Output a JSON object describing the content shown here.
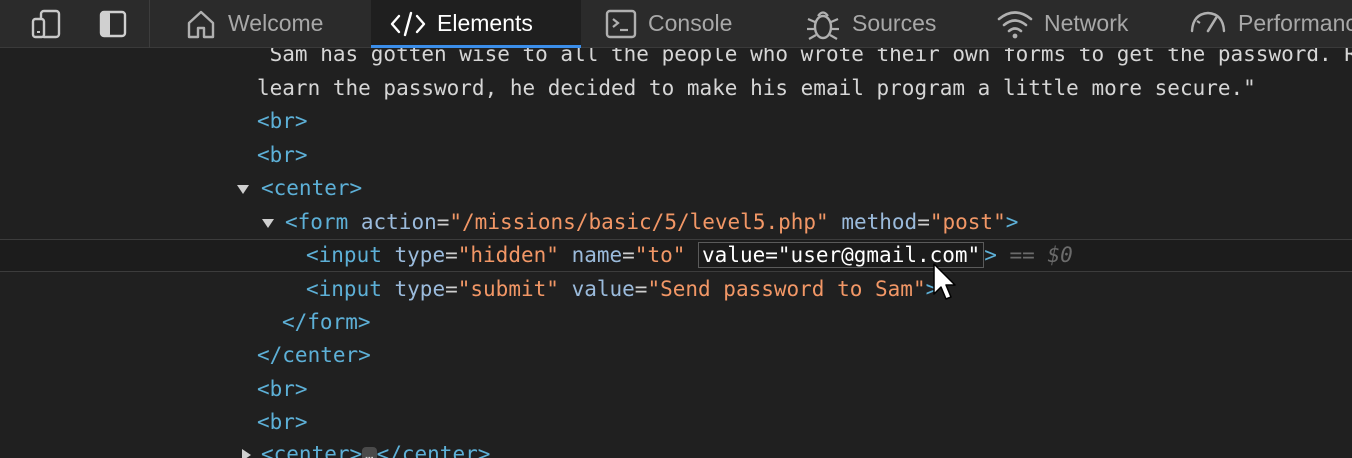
{
  "toolbar": {
    "device_icon": "device-emulation-icon",
    "dock_icon": "dock-panel-icon",
    "tabs": [
      {
        "label": "Welcome",
        "icon": "home-icon",
        "active": false
      },
      {
        "label": "Elements",
        "icon": "code-brackets-icon",
        "active": true
      },
      {
        "label": "Console",
        "icon": "console-icon",
        "active": false
      },
      {
        "label": "Sources",
        "icon": "bug-icon",
        "active": false
      },
      {
        "label": "Network",
        "icon": "wifi-icon",
        "active": false
      },
      {
        "label": "Performance",
        "icon": "gauge-icon",
        "active": false
      }
    ]
  },
  "tree": {
    "text_line1": " Sam has gotten wise to all the people who wrote their own forms to get the password. Rather than actually",
    "text_line2": "learn the password, he decided to make his email program a little more secure.\"",
    "br": "<br>",
    "center_open": "<center>",
    "center_close": "</center>",
    "form": {
      "open": "<form",
      "action_attr": "action",
      "action_val": "\"/missions/basic/5/level5.php\"",
      "method_attr": "method",
      "method_val": "\"post\"",
      "close": "</form>"
    },
    "input_hidden": {
      "open": "<input",
      "type_attr": "type",
      "type_val": "\"hidden\"",
      "name_attr": "name",
      "name_val": "\"to\"",
      "value_attr": "value",
      "value_val": "\"user@gmail.com\"",
      "selected_marker": "== $0"
    },
    "input_submit": {
      "open": "<input",
      "type_attr": "type",
      "type_val": "\"submit\"",
      "value_attr": "value",
      "value_val": "\"Send password to Sam\""
    },
    "collapsed_center_ellipsis": "…",
    "colors": {
      "tag": "#5db0d7",
      "attribute": "#9bbbdc",
      "value": "#f29766",
      "active_tab_underline": "#3b8eea"
    }
  }
}
